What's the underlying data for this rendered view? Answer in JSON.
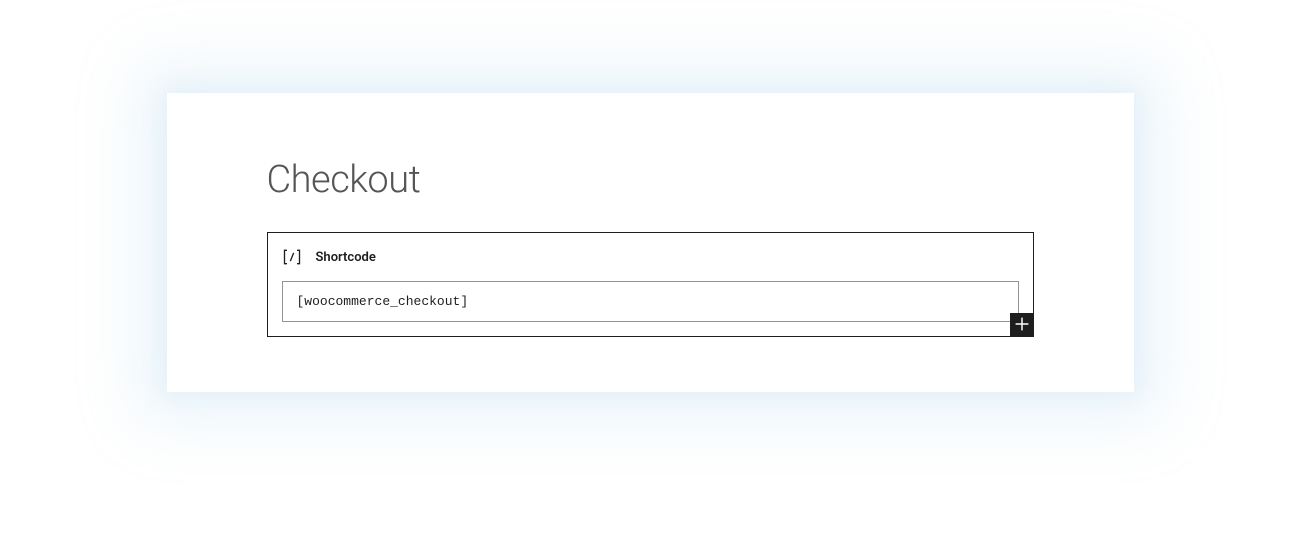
{
  "page": {
    "title": "Checkout"
  },
  "block": {
    "label": "Shortcode",
    "value": "[woocommerce_checkout]"
  }
}
